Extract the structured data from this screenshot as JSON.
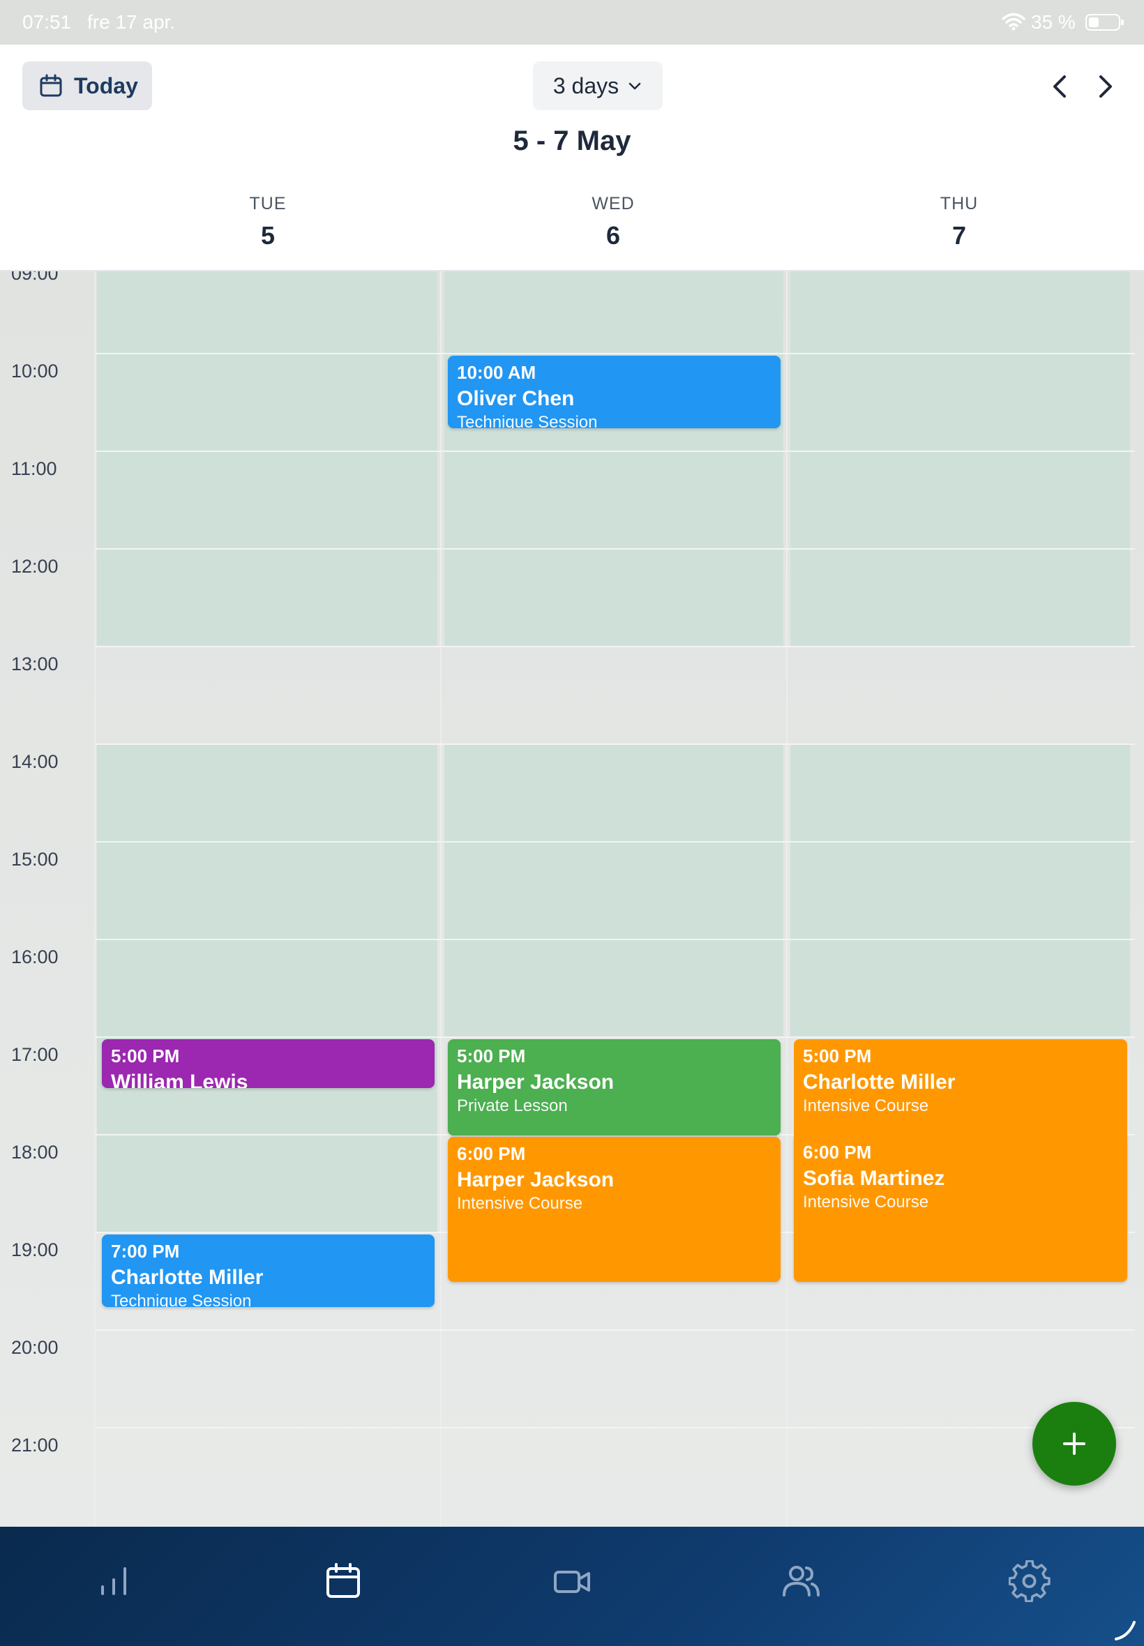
{
  "status_bar": {
    "time": "07:51",
    "date": "fre 17 apr.",
    "battery": "35 %"
  },
  "header": {
    "today_label": "Today",
    "view_label": "3 days",
    "range_title": "5 - 7 May",
    "days": [
      {
        "name": "TUE",
        "number": "5"
      },
      {
        "name": "WED",
        "number": "6"
      },
      {
        "name": "THU",
        "number": "7"
      }
    ]
  },
  "grid": {
    "hours": [
      "09:00",
      "10:00",
      "11:00",
      "12:00",
      "13:00",
      "14:00",
      "15:00",
      "16:00",
      "17:00",
      "18:00",
      "19:00",
      "20:00",
      "21:00"
    ]
  },
  "events": [
    {
      "time": "10:00 AM",
      "name": "Oliver Chen",
      "type": "Technique Session",
      "color": "#2196f3"
    },
    {
      "time": "5:00 PM",
      "name": "William Lewis",
      "type": "",
      "color": "#9c27b0"
    },
    {
      "time": "5:00 PM",
      "name": "Harper Jackson",
      "type": "Private Lesson",
      "color": "#4caf50"
    },
    {
      "time": "5:00 PM",
      "name": "Charlotte Miller",
      "type": "Intensive Course",
      "color": "#ff9800"
    },
    {
      "time": "6:00 PM",
      "name": "Harper Jackson",
      "type": "Intensive Course",
      "color": "#ff9800"
    },
    {
      "time": "6:00 PM",
      "name": "Sofia Martinez",
      "type": "Intensive Course",
      "color": "#ff9800"
    },
    {
      "time": "7:00 PM",
      "name": "Charlotte Miller",
      "type": "Technique Session",
      "color": "#2196f3"
    }
  ],
  "fab": {
    "icon": "plus-icon",
    "color": "#1a7f0e"
  },
  "bottom_nav": [
    {
      "icon": "stats-icon"
    },
    {
      "icon": "calendar-icon"
    },
    {
      "icon": "video-icon"
    },
    {
      "icon": "users-icon"
    },
    {
      "icon": "settings-icon"
    }
  ],
  "colors": {
    "available": "#cfe0d9",
    "nav_background": "#0f3b6e"
  }
}
